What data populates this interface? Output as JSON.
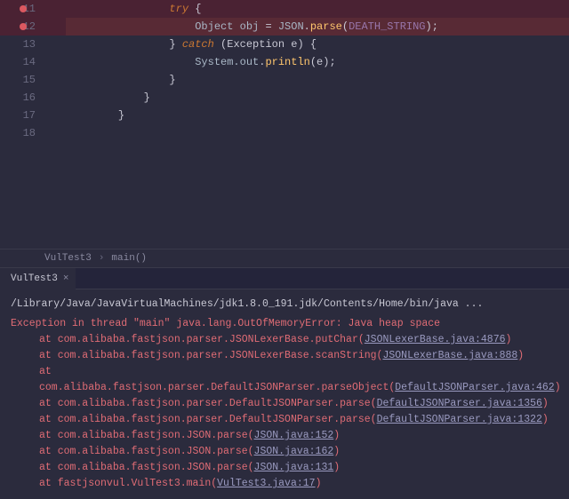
{
  "editor": {
    "lines": [
      {
        "num": 11,
        "bp": true,
        "hl": "bg",
        "tokens": [
          [
            "kw",
            "try"
          ],
          [
            "pl",
            " {"
          ]
        ],
        "indent": 3
      },
      {
        "num": 12,
        "bp": true,
        "hl": "err",
        "tokens": [
          [
            "id",
            "Object obj "
          ],
          [
            "pl",
            "= "
          ],
          [
            "id",
            "JSON"
          ],
          [
            "pl",
            "."
          ],
          [
            "fn",
            "parse"
          ],
          [
            "pl",
            "("
          ],
          [
            "const",
            "DEATH_STRING"
          ],
          [
            "pl",
            ");"
          ]
        ],
        "indent": 4
      },
      {
        "num": 13,
        "bp": false,
        "hl": "",
        "tokens": [
          [
            "pl",
            "} "
          ],
          [
            "kw",
            "catch"
          ],
          [
            "pl",
            " (Exception e) {"
          ]
        ],
        "indent": 3
      },
      {
        "num": 14,
        "bp": false,
        "hl": "",
        "tokens": [
          [
            "id",
            "System.out"
          ],
          [
            "pl",
            "."
          ],
          [
            "fn",
            "println"
          ],
          [
            "pl",
            "(e);"
          ]
        ],
        "indent": 4
      },
      {
        "num": 15,
        "bp": false,
        "hl": "",
        "tokens": [
          [
            "pl",
            "}"
          ]
        ],
        "indent": 3
      },
      {
        "num": 16,
        "bp": false,
        "hl": "",
        "tokens": [
          [
            "pl",
            "}"
          ]
        ],
        "indent": 2
      },
      {
        "num": 17,
        "bp": false,
        "hl": "",
        "tokens": [
          [
            "pl",
            "}"
          ]
        ],
        "indent": 1
      },
      {
        "num": 18,
        "bp": false,
        "hl": "",
        "tokens": [],
        "indent": 0
      }
    ]
  },
  "breadcrumb": {
    "class": "VulTest3",
    "method": "main()"
  },
  "panel": {
    "tab": "VulTest3",
    "close": "×",
    "command": "/Library/Java/JavaVirtualMachines/jdk1.8.0_191.jdk/Contents/Home/bin/java ...",
    "exception_header": "Exception in thread \"main\" java.lang.OutOfMemoryError: Java heap space",
    "trace": [
      {
        "at": "at com.alibaba.fastjson.parser.JSONLexerBase.putChar(",
        "link": "JSONLexerBase.java:4876",
        "tail": ")"
      },
      {
        "at": "at com.alibaba.fastjson.parser.JSONLexerBase.scanString(",
        "link": "JSONLexerBase.java:888",
        "tail": ")"
      },
      {
        "at": "at com.alibaba.fastjson.parser.DefaultJSONParser.parseObject(",
        "link": "DefaultJSONParser.java:462",
        "tail": ")"
      },
      {
        "at": "at com.alibaba.fastjson.parser.DefaultJSONParser.parse(",
        "link": "DefaultJSONParser.java:1356",
        "tail": ")"
      },
      {
        "at": "at com.alibaba.fastjson.parser.DefaultJSONParser.parse(",
        "link": "DefaultJSONParser.java:1322",
        "tail": ")"
      },
      {
        "at": "at com.alibaba.fastjson.JSON.parse(",
        "link": "JSON.java:152",
        "tail": ")"
      },
      {
        "at": "at com.alibaba.fastjson.JSON.parse(",
        "link": "JSON.java:162",
        "tail": ")"
      },
      {
        "at": "at com.alibaba.fastjson.JSON.parse(",
        "link": "JSON.java:131",
        "tail": ")"
      },
      {
        "at": "at fastjsonvul.VulTest3.main(",
        "link": "VulTest3.java:17",
        "tail": ")"
      }
    ]
  }
}
